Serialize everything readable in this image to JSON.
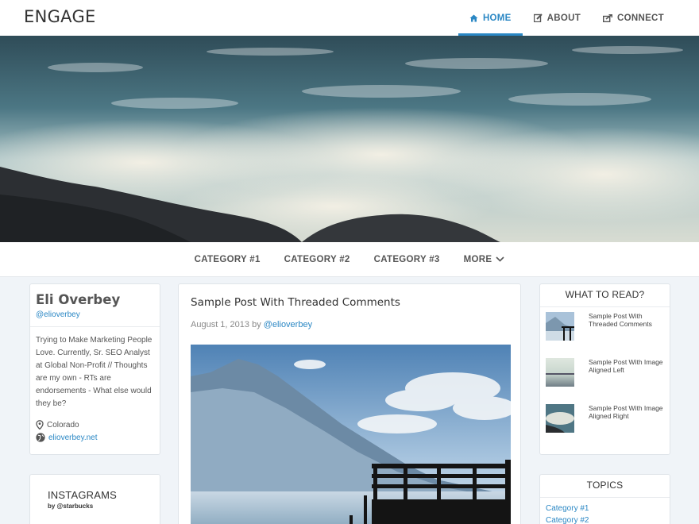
{
  "header": {
    "brand": "ENGAGE",
    "nav": [
      {
        "label": "HOME",
        "icon": "home-icon",
        "active": true
      },
      {
        "label": "ABOUT",
        "icon": "edit-icon",
        "active": false
      },
      {
        "label": "CONNECT",
        "icon": "share-icon",
        "active": false
      }
    ]
  },
  "categories": [
    "CATEGORY #1",
    "CATEGORY #2",
    "CATEGORY #3",
    "MORE"
  ],
  "profile": {
    "name": "Eli Overbey",
    "handle": "@elioverbey",
    "bio": "Trying to Make Marketing People Love. Currently, Sr. SEO Analyst at Global Non-Profit // Thoughts are my own - RTs are endorsements - What else would they be?",
    "location": "Colorado",
    "website": "elioverbey.net"
  },
  "instagrams": {
    "title": "INSTAGRAMS",
    "subtitle": "by @starbucks"
  },
  "post": {
    "title": "Sample Post With Threaded Comments",
    "date": "August 1, 2013",
    "by": "by",
    "author": "@elioverbey"
  },
  "what_to_read": {
    "title": "WHAT TO READ?",
    "items": [
      {
        "title": "Sample Post With Threaded Comments"
      },
      {
        "title": "Sample Post With Image Aligned Left"
      },
      {
        "title": "Sample Post With Image Aligned Right"
      }
    ]
  },
  "topics": {
    "title": "TOPICS",
    "items": [
      "Category #1",
      "Category #2"
    ]
  },
  "colors": {
    "accent": "#2a87c4",
    "background": "#f0f4f8"
  }
}
